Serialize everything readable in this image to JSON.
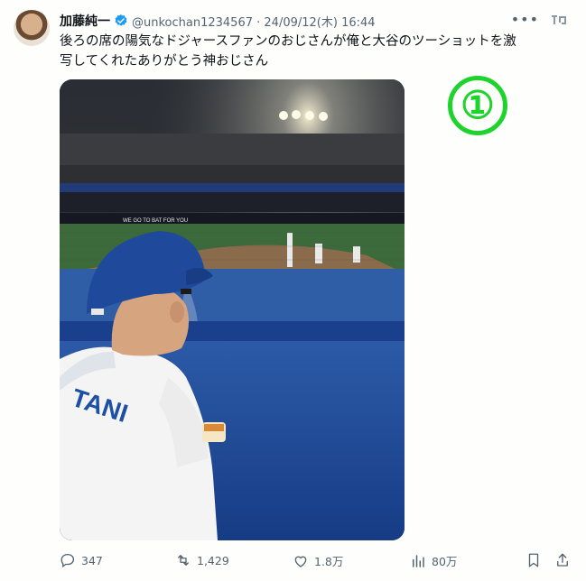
{
  "author": {
    "name": "加藤純一",
    "handle": "@unkochan1234567",
    "timestamp": "· 24/09/12(木) 16:44"
  },
  "tweet": {
    "text": "後ろの席の陽気なドジャースファンのおじさんが俺と大谷のツーショットを激写してくれたありがとう神おじさん"
  },
  "annotation": {
    "label": "①",
    "color": "#1ed42c"
  },
  "photo_content": {
    "jersey_text": "TANI",
    "banner_text": "WE GO TO BAT FOR YOU"
  },
  "actions": {
    "replies": "347",
    "retweets": "1,429",
    "likes": "1.8万",
    "views": "80万"
  },
  "icons": [
    "verified-badge-icon",
    "more-icon",
    "tweetgram-icon",
    "reply-icon",
    "retweet-icon",
    "like-icon",
    "views-icon",
    "bookmark-icon",
    "share-icon"
  ],
  "colors": {
    "accent": "#1d9bf0",
    "secondary_text": "#536471",
    "annotation": "#1ed42c"
  }
}
